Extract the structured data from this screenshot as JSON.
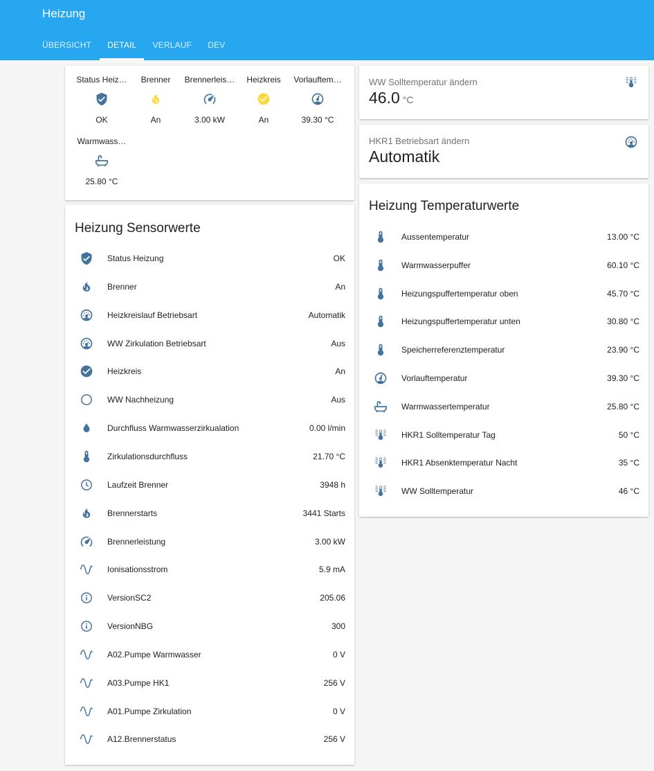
{
  "header": {
    "title": "Heizung",
    "tabs": [
      {
        "label": "ÜBERSICHT",
        "active": false
      },
      {
        "label": "DETAIL",
        "active": true
      },
      {
        "label": "VERLAUF",
        "active": false
      },
      {
        "label": "DEV",
        "active": false
      }
    ]
  },
  "colors": {
    "header_bg": "#27a7f0",
    "icon": "#44739e",
    "icon_active": "#fdd835"
  },
  "glance": {
    "items": [
      {
        "name": "Status Heiz…",
        "icon": "shield-check-icon",
        "state": "OK"
      },
      {
        "name": "Brenner",
        "icon": "fire-icon",
        "state": "An"
      },
      {
        "name": "Brennerleis…",
        "icon": "speedometer-icon",
        "state": "3.00 kW"
      },
      {
        "name": "Heizkreis",
        "icon": "check-circle-icon",
        "state": "An"
      },
      {
        "name": "Vorlauftem…",
        "icon": "gauge-icon",
        "state": "39.30 °C"
      },
      {
        "name": "Warmwass…",
        "icon": "bathtub-icon",
        "state": "25.80 °C"
      }
    ]
  },
  "ww_soll": {
    "name": "WW Solltemperatur ändern",
    "value": "46.0",
    "unit": "°C",
    "icon": "thermometer-lines-icon"
  },
  "hkr1_mode": {
    "name": "HKR1 Betriebsart ändern",
    "value": "Automatik",
    "icon": "gauge-icon"
  },
  "sensors": {
    "title": "Heizung Sensorwerte",
    "rows": [
      {
        "icon": "shield-check-icon",
        "name": "Status Heizung",
        "value": "OK"
      },
      {
        "icon": "fire-icon",
        "name": "Brenner",
        "value": "An"
      },
      {
        "icon": "gauge-circle-icon",
        "name": "Heizkreislauf Betriebsart",
        "value": "Automatik"
      },
      {
        "icon": "gauge-circle-icon",
        "name": "WW Zirkulation Betriebsart",
        "value": "Aus"
      },
      {
        "icon": "check-circle-icon",
        "name": "Heizkreis",
        "value": "An"
      },
      {
        "icon": "circle-outline-icon",
        "name": "WW Nachheizung",
        "value": "Aus"
      },
      {
        "icon": "water-drop-icon",
        "name": "Durchfluss Warmwasserzirkualation",
        "value": "0.00 l/min"
      },
      {
        "icon": "thermometer-icon",
        "name": "Zirkulationsdurchfluss",
        "value": "21.70 °C"
      },
      {
        "icon": "clock-icon",
        "name": "Laufzeit Brenner",
        "value": "3948 h"
      },
      {
        "icon": "fire-icon",
        "name": "Brennerstarts",
        "value": "3441 Starts"
      },
      {
        "icon": "speedometer-icon",
        "name": "Brennerleistung",
        "value": "3.00 kW"
      },
      {
        "icon": "sine-wave-icon",
        "name": "Ionisationsstrom",
        "value": "5.9 mA"
      },
      {
        "icon": "info-icon",
        "name": "VersionSC2",
        "value": "205.06"
      },
      {
        "icon": "info-icon",
        "name": "VersionNBG",
        "value": "300"
      },
      {
        "icon": "sine-wave-icon",
        "name": "A02.Pumpe Warmwasser",
        "value": "0 V"
      },
      {
        "icon": "sine-wave-icon",
        "name": "A03.Pumpe HK1",
        "value": "256 V"
      },
      {
        "icon": "sine-wave-icon",
        "name": "A01.Pumpe Zirkulation",
        "value": "0 V"
      },
      {
        "icon": "sine-wave-icon",
        "name": "A12.Brennerstatus",
        "value": "256 V"
      }
    ]
  },
  "temps": {
    "title": "Heizung Temperaturwerte",
    "rows": [
      {
        "icon": "thermometer-icon",
        "name": "Aussentemperatur",
        "value": "13.00 °C"
      },
      {
        "icon": "thermometer-icon",
        "name": "Warmwasserpuffer",
        "value": "60.10 °C"
      },
      {
        "icon": "thermometer-icon",
        "name": "Heizungspuffertemperatur oben",
        "value": "45.70 °C"
      },
      {
        "icon": "thermometer-icon",
        "name": "Heizungspuffertemperatur unten",
        "value": "30.80 °C"
      },
      {
        "icon": "thermometer-icon",
        "name": "Speicherreferenztemperatur",
        "value": "23.90 °C"
      },
      {
        "icon": "gauge-icon",
        "name": "Vorlauftemperatur",
        "value": "39.30 °C"
      },
      {
        "icon": "bathtub-icon",
        "name": "Warmwassertemperatur",
        "value": "25.80 °C"
      },
      {
        "icon": "thermometer-lines-icon",
        "name": "HKR1 Solltemperatur Tag",
        "value": "50 °C"
      },
      {
        "icon": "thermometer-lines-icon",
        "name": "HKR1 Absenktemperatur Nacht",
        "value": "35 °C"
      },
      {
        "icon": "thermometer-lines-icon",
        "name": "WW Solltemperatur",
        "value": "46 °C"
      }
    ]
  }
}
